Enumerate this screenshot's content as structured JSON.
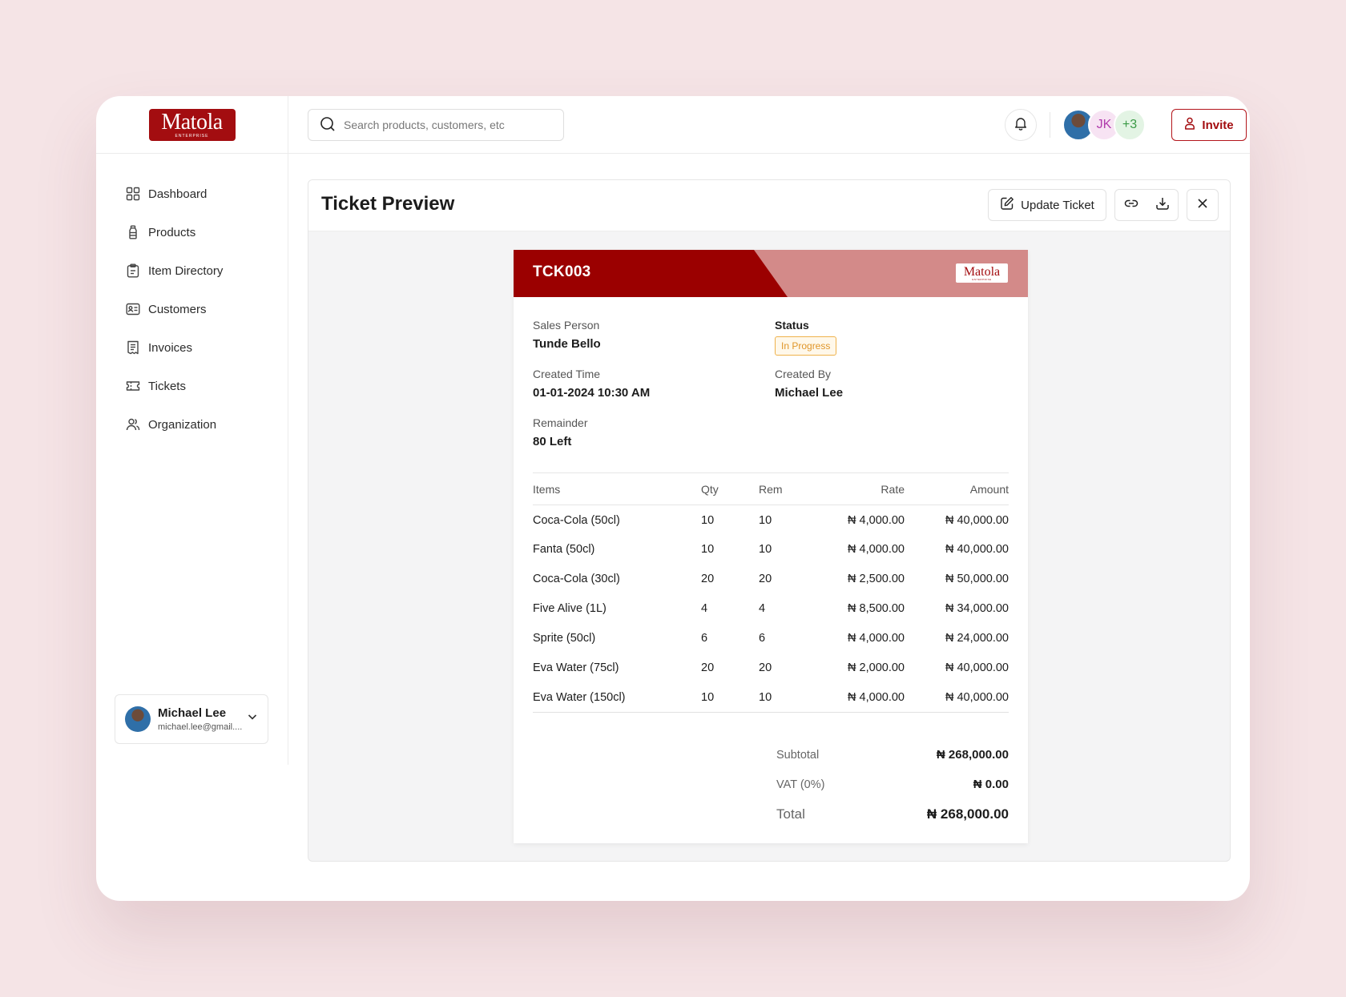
{
  "brand": {
    "logo_text": "Matola",
    "logo_subtext": "ENTERPRISE"
  },
  "search": {
    "placeholder": "Search products, customers, etc"
  },
  "sidebar": {
    "items": [
      {
        "label": "Dashboard",
        "icon": "dashboard-icon"
      },
      {
        "label": "Products",
        "icon": "bottle-icon"
      },
      {
        "label": "Item Directory",
        "icon": "clipboard-icon"
      },
      {
        "label": "Customers",
        "icon": "id-card-icon"
      },
      {
        "label": "Invoices",
        "icon": "receipt-icon"
      },
      {
        "label": "Tickets",
        "icon": "ticket-icon"
      },
      {
        "label": "Organization",
        "icon": "users-icon"
      }
    ],
    "user": {
      "name": "Michael Lee",
      "email": "michael.lee@gmail...."
    }
  },
  "header": {
    "avatars": {
      "second_initials": "JK",
      "more_count": "+3"
    },
    "invite_label": "Invite"
  },
  "panel": {
    "title": "Ticket Preview",
    "update_label": "Update Ticket"
  },
  "ticket": {
    "id": "TCK003",
    "logo_text": "Matola",
    "logo_subtext": "ENTERPRISE",
    "sales_person_label": "Sales Person",
    "sales_person": "Tunde Bello",
    "status_label": "Status",
    "status": "In Progress",
    "created_time_label": "Created Time",
    "created_time": "01-01-2024 10:30 AM",
    "created_by_label": "Created By",
    "created_by": "Michael Lee",
    "remainder_label": "Remainder",
    "remainder": "80 Left",
    "columns": [
      "Items",
      "Qty",
      "Rem",
      "Rate",
      "Amount"
    ],
    "rows": [
      [
        "Coca-Cola (50cl)",
        "10",
        "10",
        "₦ 4,000.00",
        "₦ 40,000.00"
      ],
      [
        "Fanta (50cl)",
        "10",
        "10",
        "₦ 4,000.00",
        "₦ 40,000.00"
      ],
      [
        "Coca-Cola (30cl)",
        "20",
        "20",
        "₦ 2,500.00",
        "₦ 50,000.00"
      ],
      [
        "Five Alive (1L)",
        "4",
        "4",
        "₦ 8,500.00",
        "₦ 34,000.00"
      ],
      [
        "Sprite (50cl)",
        "6",
        "6",
        "₦ 4,000.00",
        "₦ 24,000.00"
      ],
      [
        "Eva Water (75cl)",
        "20",
        "20",
        "₦ 2,000.00",
        "₦ 40,000.00"
      ],
      [
        "Eva Water (150cl)",
        "10",
        "10",
        "₦ 4,000.00",
        "₦ 40,000.00"
      ]
    ],
    "subtotal_label": "Subtotal",
    "subtotal": "₦ 268,000.00",
    "vat_label": "VAT (0%)",
    "vat": "₦ 0.00",
    "total_label": "Total",
    "total": "₦ 268,000.00"
  },
  "colors": {
    "brand_red": "#9b0000",
    "brand_red_light": "#d38a89",
    "status_amber": "#efb24c",
    "background": "#f5e4e6"
  }
}
